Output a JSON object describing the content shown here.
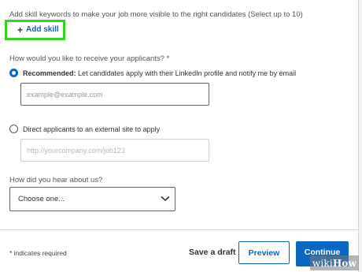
{
  "skills": {
    "prompt": "Add skill keywords to make your job more visible to the right candidates (Select up to 10)",
    "add_skill_label": "Add skill",
    "add_icon": "plus-icon",
    "highlight_color": "#31d420"
  },
  "applicants": {
    "question": "How would you like to receive your applicants? *",
    "option_recommended": {
      "bold_label": "Recommended:",
      "label": " Let candidates apply with their LinkedIn profile and notify me by email",
      "selected": true,
      "email_placeholder": "example@example.com"
    },
    "option_external": {
      "label": "Direct applicants to an external site to apply",
      "selected": false,
      "url_placeholder": "http://yourcompany.com/job123"
    }
  },
  "referral": {
    "question": "How did you hear about us?",
    "selected_value": "Choose one...",
    "dropdown_icon": "chevron-down-icon"
  },
  "footer": {
    "required_note": "* indicates required",
    "save_draft_label": "Save a draft",
    "preview_label": "Preview",
    "continue_label": "Continue"
  },
  "colors": {
    "accent": "#0a66c2"
  },
  "watermark": {
    "prefix": "wiki",
    "suffix": "How"
  }
}
